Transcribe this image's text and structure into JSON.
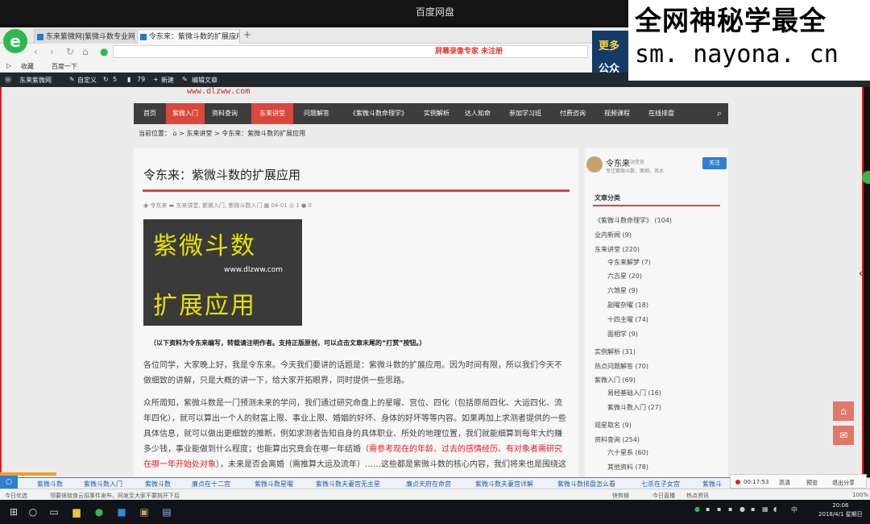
{
  "window": {
    "title": "百度网盘"
  },
  "watermark": {
    "line1": "全网神秘学最全",
    "line2": "sm. nayona. cn"
  },
  "browser": {
    "tabs": [
      {
        "label": "东来紫微网|紫微斗数专业网站"
      },
      {
        "label": "令东来：紫微斗数的扩展应用|东..."
      }
    ],
    "new_tab": "+",
    "center_note": "屏幕录像专家  未注册",
    "bookmarks": [
      "收藏",
      "百度一下"
    ]
  },
  "promo": {
    "line1": "更多",
    "line2": "公众"
  },
  "wp_admin": {
    "site_name": "东来紫微网",
    "customize": "自定义",
    "updates": "5",
    "comments": "79",
    "new": "新建",
    "edit": "编辑文章"
  },
  "faint_url": "www.dlzww.com",
  "nav": {
    "items": [
      "首页",
      "紫微入门",
      "资料查询",
      "东来讲堂",
      "问题解答",
      "《紫微斗数命理学》",
      "实例解析",
      "达人知命",
      "参加学习班",
      "付费咨询",
      "视频课程",
      "在线排盘"
    ],
    "search_icon": "search-icon"
  },
  "breadcrumb": {
    "prefix": "当前位置：",
    "path": "> 东来讲堂 > 令东来：紫微斗数的扩展应用"
  },
  "post": {
    "title": "令东来：紫微斗数的扩展应用",
    "meta": {
      "author": "令东来",
      "categories": "东来讲堂, 紫微入门, 紫微斗数入门",
      "date": "04-01",
      "views": "1",
      "comments": "0"
    },
    "image": {
      "line1": "紫微斗数",
      "url": "www.dlzww.com",
      "line2": "扩展应用"
    },
    "notice": "（以下资料为令东来编写，转载请注明作者。支持正版原创，可以点击文章末尾的“打赏”按钮。）",
    "para1": "各位同学，大家晚上好，我是令东来。今天我们要讲的话题是：紫微斗数的扩展应用。因为时间有限，所以我们今天不做细致的讲解，只是大概的讲一下，给大家开拓眼界，同时提供一些思路。",
    "para2_a": "众所周知，紫微斗数是一门预测未来的学问，我们通过研究命盘上的星曜、宫位、四化（包括原局四化、大运四化、流年四化），就可以算出一个人的财富上限、事业上限、婚姻的好坏、身体的好坏等等内容。如果再加上求测者提供的一些具体信息，就可以做出更细致的推断，例如求测者告知自身的具体职业、所处的地理位置，我们就能细算到每年大约赚多少钱，事业能做到什么程度；也能算出究竟会在哪一年结婚（",
    "para2_red": "需参考现在的年龄、过去的感情经历、有对象者需研究在哪一年开始处对象",
    "para2_b": "），未来是否会离婚（需推算大运及流年）……这些都是紫微斗数的核心内容，我们将来也是围绕这些核心内容展开的。"
  },
  "sidebar": {
    "author_name": "令东来",
    "author_role": "站堂员",
    "author_desc": "专注紫微斗数，面相，风水",
    "follow_label": "关注",
    "heading": "文章分类",
    "categories": [
      {
        "label": "《紫微斗数命理学》 (104)",
        "indent": false
      },
      {
        "label": "业内新闻 (9)",
        "indent": false
      },
      {
        "label": "东来讲堂 (220)",
        "indent": false
      },
      {
        "label": "令东来解梦 (7)",
        "indent": true
      },
      {
        "label": "六吉星 (20)",
        "indent": true
      },
      {
        "label": "六煞星 (9)",
        "indent": true
      },
      {
        "label": "副曜杂曜 (18)",
        "indent": true
      },
      {
        "label": "十四主曜 (74)",
        "indent": true
      },
      {
        "label": "面相学 (9)",
        "indent": true
      },
      {
        "label": "实例解析 (31)",
        "indent": false
      },
      {
        "label": "热点问题解答 (70)",
        "indent": false
      },
      {
        "label": "紫微入门 (69)",
        "indent": false
      },
      {
        "label": "易经基础入门 (16)",
        "indent": true
      },
      {
        "label": "紫微斗数入门 (27)",
        "indent": true
      },
      {
        "label": "观星取名 (9)",
        "indent": false
      },
      {
        "label": "资料查询 (254)",
        "indent": false
      },
      {
        "label": "六十星系 (60)",
        "indent": true
      },
      {
        "label": "其他资料 (78)",
        "indent": true
      }
    ]
  },
  "keywords": [
    "紫微斗数",
    "紫微斗数入门",
    "紫微斗数",
    "廉贞在十二宫",
    "紫微斗数星曜",
    "紫微斗数夫妻宫无主星",
    "廉贞天府在命宫",
    "紫微斗数夫妻宫详解",
    "紫微斗数排盘怎么看",
    "七杀在子女宫",
    "紫微斗"
  ],
  "recorder": {
    "time": "00:17:53",
    "quality": "高清",
    "preview": "预览",
    "exit": "退出分享"
  },
  "status_bar": {
    "left1": "今日优选",
    "left2": "领要很就食云招事件发布，同发至大家不要挑开下后",
    "right_items": [
      "快剪辑",
      "今日直播",
      "热点资讯"
    ],
    "zoom": "100%"
  },
  "taskbar": {
    "time": "20:06",
    "date": "2018/4/1 星期日",
    "ime": "中"
  }
}
